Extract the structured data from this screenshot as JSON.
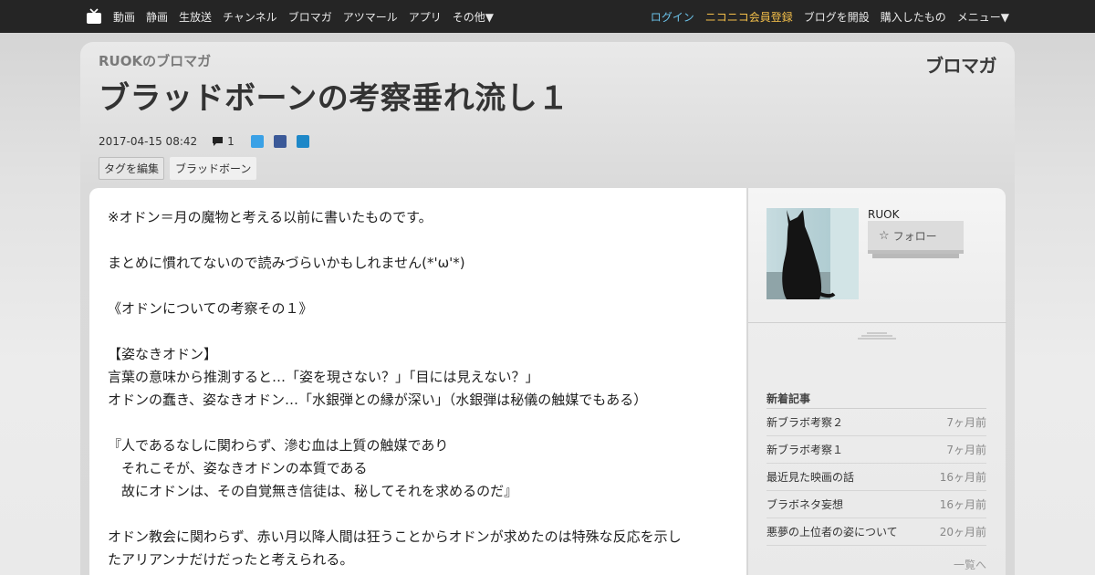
{
  "nav": {
    "left": [
      "動画",
      "静画",
      "生放送",
      "チャンネル",
      "ブロマガ",
      "アツマール",
      "アプリ",
      "その他▼"
    ],
    "login": "ログイン",
    "register": "ニコニコ会員登録",
    "open_blog": "ブログを開設",
    "purchased": "購入したもの",
    "menu": "メニュー▼"
  },
  "header": {
    "blog_name": "RUOKのブロマガ",
    "title": "ブラッドボーンの考察垂れ流し１",
    "logo": "ブロマガ",
    "date": "2017-04-15 08:42",
    "comment_count": "1",
    "edit_tags": "タグを編集",
    "tag": "ブラッドボーン"
  },
  "article": {
    "lines": [
      "※オドン＝月の魔物と考える以前に書いたものです。",
      "",
      "まとめに慣れてないので読みづらいかもしれません(*'ω'*)",
      "",
      "《オドンについての考察その１》",
      "",
      "【姿なきオドン】",
      "言葉の意味から推測すると…「姿を現さない？」「目には見えない？」",
      "オドンの蠢き、姿なきオドン…「水銀弾との縁が深い」（水銀弾は秘儀の触媒でもある）",
      "",
      "『人であるなしに関わらず、滲む血は上質の触媒であり",
      "　それこそが、姿なきオドンの本質である",
      "　故にオドンは、その自覚無き信徒は、秘してそれを求めるのだ』",
      "",
      "オドン教会に関わらず、赤い月以降人間は狂うことからオドンが求めたのは特殊な反応を示し",
      "たアリアンナだけだったと考えられる。"
    ]
  },
  "sidebar": {
    "author": "RUOK",
    "follow": "フォロー",
    "recent_title": "新着記事",
    "recent": [
      {
        "title": "新ブラボ考察２",
        "date": "7ヶ月前"
      },
      {
        "title": "新ブラボ考察１",
        "date": "7ヶ月前"
      },
      {
        "title": "最近見た映画の話",
        "date": "16ヶ月前"
      },
      {
        "title": "ブラボネタ妄想",
        "date": "16ヶ月前"
      },
      {
        "title": "悪夢の上位者の姿について",
        "date": "20ヶ月前"
      }
    ],
    "more": "一覧へ"
  }
}
